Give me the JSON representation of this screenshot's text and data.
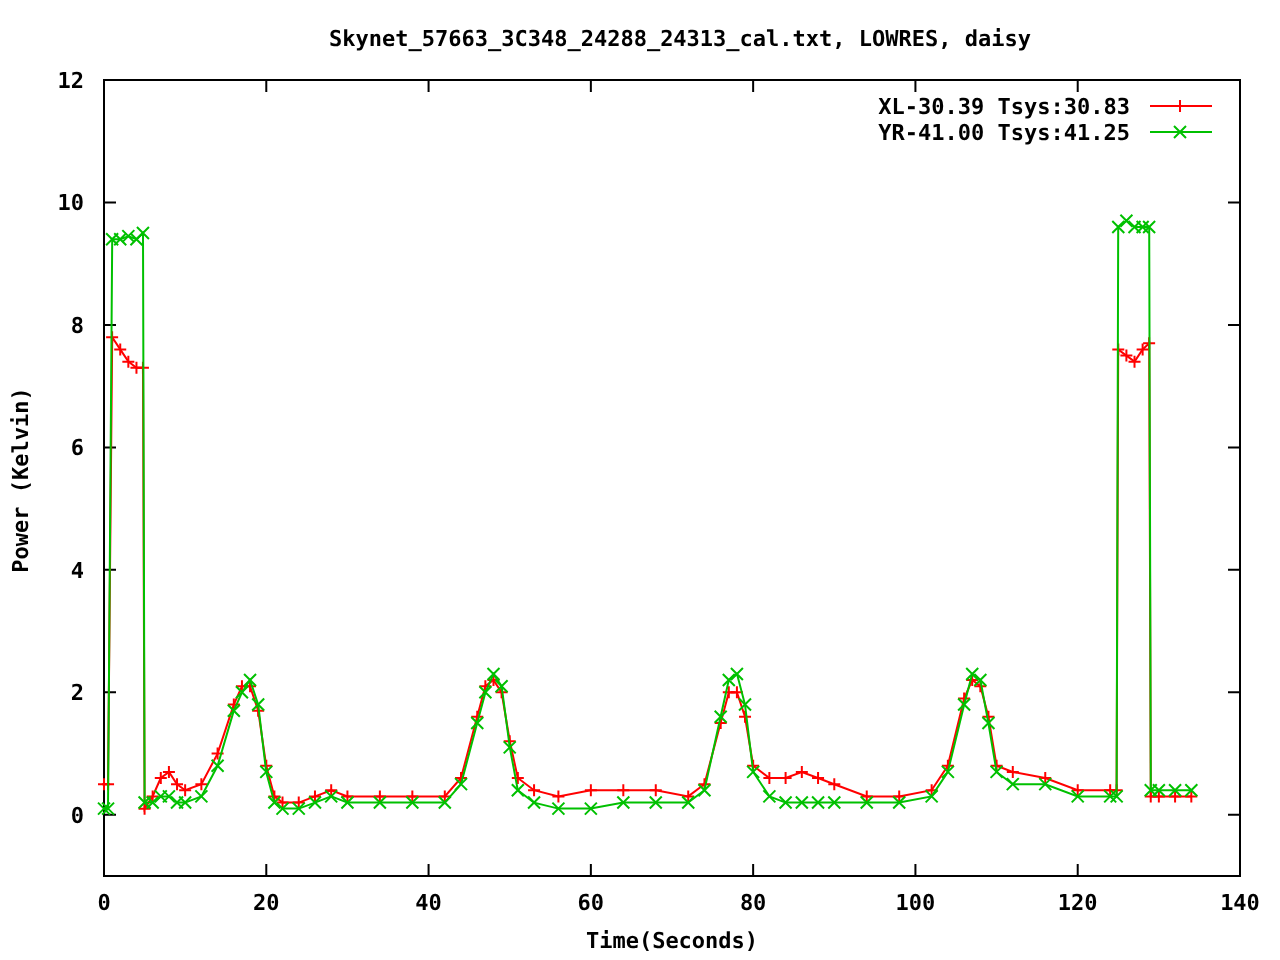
{
  "chart_data": {
    "type": "line",
    "title": "Skynet_57663_3C348_24288_24313_cal.txt, LOWRES, daisy",
    "xlabel": "Time(Seconds)",
    "ylabel": "Power (Kelvin)",
    "xlim": [
      0,
      140
    ],
    "ylim": [
      -1,
      12
    ],
    "xticks": [
      0,
      20,
      40,
      60,
      80,
      100,
      120,
      140
    ],
    "yticks": [
      0,
      2,
      4,
      6,
      8,
      10,
      12
    ],
    "legend": true,
    "x": [
      0,
      0.5,
      1,
      2,
      3,
      4,
      4.8,
      5,
      6,
      7,
      8,
      9,
      10,
      12,
      14,
      16,
      17,
      18,
      19,
      20,
      21,
      22,
      24,
      26,
      28,
      30,
      34,
      38,
      42,
      44,
      46,
      47,
      48,
      49,
      50,
      51,
      53,
      56,
      60,
      64,
      68,
      72,
      74,
      76,
      77,
      78,
      79,
      80,
      82,
      84,
      86,
      88,
      90,
      94,
      98,
      102,
      104,
      106,
      107,
      108,
      109,
      110,
      112,
      116,
      120,
      124,
      124.8,
      125,
      126,
      127,
      128,
      128.8,
      129,
      130,
      132,
      134
    ],
    "series": [
      {
        "name": "XL-30.39 Tsys:30.83",
        "color": "#ff0000",
        "marker": "+",
        "values": [
          0.5,
          0.5,
          7.8,
          7.6,
          7.4,
          7.3,
          7.3,
          0.1,
          0.3,
          0.6,
          0.7,
          0.5,
          0.4,
          0.5,
          1.0,
          1.8,
          2.1,
          2.1,
          1.7,
          0.8,
          0.3,
          0.2,
          0.2,
          0.3,
          0.4,
          0.3,
          0.3,
          0.3,
          0.3,
          0.6,
          1.6,
          2.1,
          2.2,
          2.0,
          1.2,
          0.6,
          0.4,
          0.3,
          0.4,
          0.4,
          0.4,
          0.3,
          0.5,
          1.5,
          2.0,
          2.0,
          1.6,
          0.8,
          0.6,
          0.6,
          0.7,
          0.6,
          0.5,
          0.3,
          0.3,
          0.4,
          0.8,
          1.9,
          2.2,
          2.1,
          1.6,
          0.8,
          0.7,
          0.6,
          0.4,
          0.4,
          0.4,
          7.6,
          7.5,
          7.4,
          7.6,
          7.7,
          0.3,
          0.3,
          0.3,
          0.3
        ]
      },
      {
        "name": "YR-41.00 Tsys:41.25",
        "color": "#00c000",
        "marker": "x",
        "values": [
          0.1,
          0.1,
          9.4,
          9.4,
          9.45,
          9.4,
          9.5,
          0.2,
          0.2,
          0.3,
          0.3,
          0.2,
          0.2,
          0.3,
          0.8,
          1.7,
          2.0,
          2.2,
          1.8,
          0.7,
          0.2,
          0.1,
          0.1,
          0.2,
          0.3,
          0.2,
          0.2,
          0.2,
          0.2,
          0.5,
          1.5,
          2.0,
          2.3,
          2.1,
          1.1,
          0.4,
          0.2,
          0.1,
          0.1,
          0.2,
          0.2,
          0.2,
          0.4,
          1.6,
          2.2,
          2.3,
          1.8,
          0.7,
          0.3,
          0.2,
          0.2,
          0.2,
          0.2,
          0.2,
          0.2,
          0.3,
          0.7,
          1.8,
          2.3,
          2.2,
          1.5,
          0.7,
          0.5,
          0.5,
          0.3,
          0.3,
          0.3,
          9.6,
          9.7,
          9.6,
          9.6,
          9.6,
          0.4,
          0.4,
          0.4,
          0.4
        ]
      }
    ]
  }
}
